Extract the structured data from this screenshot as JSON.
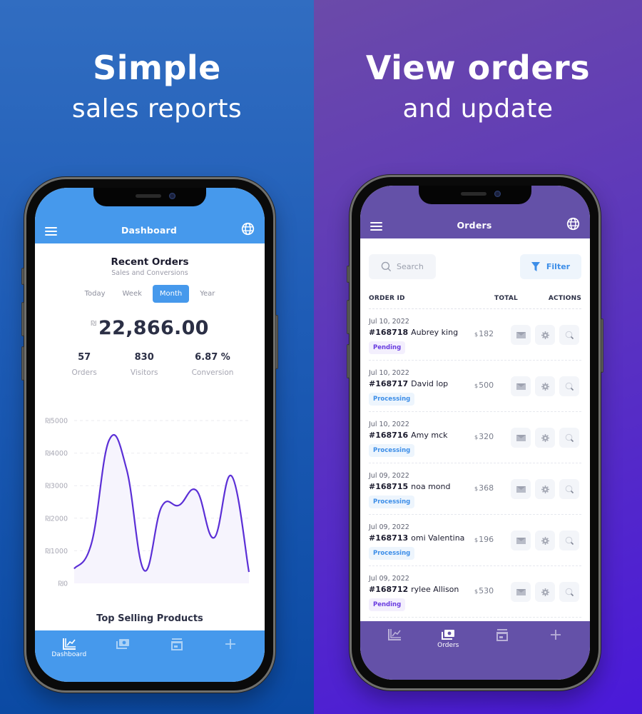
{
  "left_panel": {
    "headline": "Simple",
    "subheadline": "sales reports",
    "colors": {
      "bg_top": "#316dc1",
      "bg_bottom": "#0b4aa3",
      "accent": "#4699ec"
    }
  },
  "right_panel": {
    "headline": "View orders",
    "subheadline": "and update",
    "colors": {
      "bg_top": "#6b4aa9",
      "bg_bottom": "#4a19d9",
      "accent": "#6451a8"
    }
  },
  "dashboard": {
    "appbar": {
      "title": "Dashboard",
      "menu_icon": "hamburger-icon",
      "lang_icon": "globe-icon"
    },
    "section_title": "Recent Orders",
    "section_subtitle": "Sales and Conversions",
    "periods": [
      {
        "label": "Today",
        "active": false
      },
      {
        "label": "Week",
        "active": false
      },
      {
        "label": "Month",
        "active": true
      },
      {
        "label": "Year",
        "active": false
      }
    ],
    "currency_symbol": "₪",
    "total_amount": "22,866.00",
    "stats": [
      {
        "value": "57",
        "label": "Orders"
      },
      {
        "value": "830",
        "label": "Visitors"
      },
      {
        "value": "6.87 %",
        "label": "Conversion"
      }
    ],
    "top_selling_title": "Top Selling Products",
    "bottom_nav": [
      {
        "label": "Dashboard",
        "icon": "chart-line-icon",
        "active": true
      },
      {
        "label": "",
        "icon": "money-icon",
        "active": false
      },
      {
        "label": "",
        "icon": "store-icon",
        "active": false
      },
      {
        "label": "",
        "icon": "plus-icon",
        "active": false
      }
    ]
  },
  "chart_data": {
    "type": "area",
    "title": "",
    "xlabel": "",
    "ylabel": "",
    "x": [
      1,
      2,
      3,
      4,
      5,
      6,
      7,
      8,
      9,
      10,
      11
    ],
    "series": [
      {
        "name": "Sales",
        "values": [
          450,
          1250,
          4400,
          3500,
          400,
          2350,
          2400,
          2850,
          1400,
          3300,
          350
        ],
        "color": "#5b2fd6",
        "fill": "#f6f4fd"
      }
    ],
    "xticks": [
      2,
      4,
      6,
      8,
      10
    ],
    "yticks": [
      0,
      1000,
      2000,
      3000,
      4000,
      5000
    ],
    "ytick_labels": [
      "₪0",
      "₪1000",
      "₪2000",
      "₪3000",
      "₪4000",
      "₪5000"
    ],
    "xlim": [
      1,
      11
    ],
    "ylim": [
      0,
      5000
    ],
    "grid": true,
    "legend": "none"
  },
  "orders": {
    "appbar": {
      "title": "Orders",
      "menu_icon": "hamburger-icon",
      "lang_icon": "globe-icon"
    },
    "search_placeholder": "Search",
    "filter_label": "Filter",
    "columns": [
      "ORDER ID",
      "TOTAL",
      "ACTIONS"
    ],
    "rows": [
      {
        "date": "Jul 10, 2022",
        "id": "#168718",
        "customer": "Aubrey king",
        "currency": "$",
        "total": "182",
        "status": "Pending"
      },
      {
        "date": "Jul 10, 2022",
        "id": "#168717",
        "customer": "David lop",
        "currency": "$",
        "total": "500",
        "status": "Processing"
      },
      {
        "date": "Jul 10, 2022",
        "id": "#168716",
        "customer": "Amy mck",
        "currency": "$",
        "total": "320",
        "status": "Processing"
      },
      {
        "date": "Jul 09, 2022",
        "id": "#168715",
        "customer": "noa mond",
        "currency": "$",
        "total": "368",
        "status": "Processing"
      },
      {
        "date": "Jul 09, 2022",
        "id": "#168713",
        "customer": "omi Valentina",
        "currency": "$",
        "total": "196",
        "status": "Processing"
      },
      {
        "date": "Jul 09, 2022",
        "id": "#168712",
        "customer": "rylee Allison",
        "currency": "$",
        "total": "530",
        "status": "Pending"
      }
    ],
    "row_actions": [
      "mail-icon",
      "gear-icon",
      "search-icon"
    ],
    "bottom_nav": [
      {
        "label": "",
        "icon": "chart-line-icon",
        "active": false
      },
      {
        "label": "Orders",
        "icon": "money-icon",
        "active": true
      },
      {
        "label": "",
        "icon": "store-icon",
        "active": false
      },
      {
        "label": "",
        "icon": "plus-icon",
        "active": false
      }
    ]
  }
}
